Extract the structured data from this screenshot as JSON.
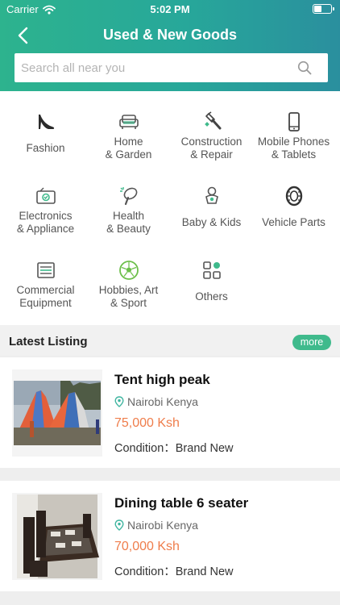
{
  "status": {
    "carrier": "Carrier",
    "time": "5:02 PM"
  },
  "header": {
    "title": "Used & New Goods"
  },
  "search": {
    "placeholder": "Search all near you"
  },
  "categories": [
    {
      "label": "Fashion",
      "icon": "heel-shoe-icon"
    },
    {
      "label": "Home\n& Garden",
      "icon": "sofa-icon"
    },
    {
      "label": "Construction\n& Repair",
      "icon": "hammer-icon"
    },
    {
      "label": "Mobile Phones\n& Tablets",
      "icon": "smartphone-icon"
    },
    {
      "label": "Electronics\n& Appliance",
      "icon": "radio-icon"
    },
    {
      "label": "Health\n& Beauty",
      "icon": "hairdryer-icon"
    },
    {
      "label": "Baby & Kids",
      "icon": "baby-icon"
    },
    {
      "label": "Vehicle Parts",
      "icon": "tire-icon"
    },
    {
      "label": "Commercial\nEquipment",
      "icon": "equipment-icon"
    },
    {
      "label": "Hobbies, Art\n& Sport",
      "icon": "soccer-ball-icon"
    },
    {
      "label": "Others",
      "icon": "grid-icon"
    }
  ],
  "latest": {
    "title": "Latest Listing",
    "more_label": "more"
  },
  "listings": [
    {
      "title": "Tent high peak",
      "location": "Nairobi Kenya",
      "price": "75,000 Ksh",
      "condition": "Condition：Brand New"
    },
    {
      "title": "Dining table 6 seater",
      "location": "Nairobi Kenya",
      "price": "70,000 Ksh",
      "condition": "Condition：Brand New"
    }
  ],
  "colors": {
    "accent": "#3fba8c",
    "header_start": "#2db38e",
    "header_end": "#2a8f9e",
    "price": "#ef7d4b"
  }
}
